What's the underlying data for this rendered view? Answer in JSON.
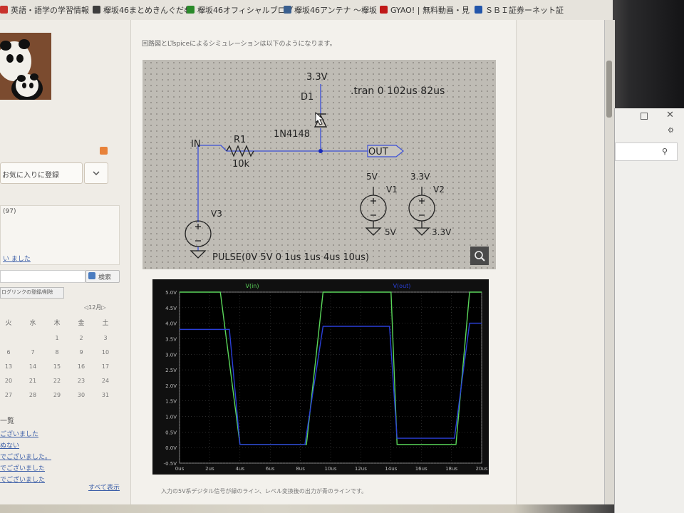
{
  "bookmarks": [
    {
      "label": "英語・語学の学習情報",
      "color": "#c8322c"
    },
    {
      "label": "欅坂46まとめきんぐだむ",
      "color": "#3d3d3d"
    },
    {
      "label": "欅坂46オフィシャルブログ",
      "color": "#2a8a2a"
    },
    {
      "label": "欅坂46アンテナ ～欅坂",
      "color": "#3a5f8f"
    },
    {
      "label": "GYAO! | 無料動画・見",
      "color": "#c01818"
    },
    {
      "label": "ＳＢＩ証券ーネット証",
      "color": "#2255aa"
    }
  ],
  "sidebar": {
    "favorite_label": "お気に入りに登録",
    "article_count": "(97)",
    "comment_link": "い ました",
    "search_label": "検索",
    "link_register": "ログリンクの登録/削除",
    "month": "12月",
    "weekdays": [
      "火",
      "水",
      "木",
      "金",
      "土"
    ],
    "calendar_rows": [
      [
        "",
        "",
        "1",
        "2",
        "3"
      ],
      [
        "6",
        "7",
        "8",
        "9",
        "10"
      ],
      [
        "13",
        "14",
        "15",
        "16",
        "17"
      ],
      [
        "20",
        "21",
        "22",
        "23",
        "24"
      ],
      [
        "27",
        "28",
        "29",
        "30",
        "31"
      ]
    ],
    "list_title": "一覧",
    "list_links": [
      "ございました",
      "ぬない",
      "でございました。",
      "でございました",
      "でございました"
    ],
    "show_all": "すべて表示"
  },
  "article": {
    "intro": "回路図とLTspiceによるシミュレーションは以下のようになります。",
    "footer": "入力の5V系デジタル信号が緑のライン、レベル変換後の出力が青のラインです。"
  },
  "schematic": {
    "vcc_label": "3.3V",
    "diode_name": "D1",
    "diode_model": "1N4148",
    "tran_cmd": ".tran 0 102us 82us",
    "in_label": "IN",
    "resistor_name": "R1",
    "resistor_value": "10k",
    "out_label": "OUT",
    "v1_top": "5V",
    "v1_name": "V1",
    "v1_gnd": "5V",
    "v2_top": "3.3V",
    "v2_name": "V2",
    "v2_gnd": "3.3V",
    "v3_name": "V3",
    "v3_params": "PULSE(0V 5V 0 1us 1us 4us 10us)"
  },
  "chart_data": {
    "type": "line",
    "title": "",
    "xlabel": "",
    "ylabel": "",
    "series": [
      {
        "name": "V(in)",
        "color": "#5ad65a",
        "x": [
          0,
          2.7,
          4.0,
          8.4,
          9.5,
          14.0,
          14.4,
          18.3,
          19.2,
          20
        ],
        "y": [
          5.0,
          5.0,
          0.1,
          0.1,
          5.0,
          5.0,
          0.1,
          0.1,
          5.0,
          5.0
        ]
      },
      {
        "name": "V(out)",
        "color": "#2a3fd8",
        "x": [
          0,
          3.3,
          4.0,
          8.3,
          9.5,
          13.9,
          14.4,
          18.2,
          19.2,
          20
        ],
        "y": [
          3.8,
          3.8,
          0.1,
          0.1,
          3.9,
          3.9,
          0.3,
          0.3,
          4.0,
          4.0
        ]
      }
    ],
    "xlim": [
      0,
      20
    ],
    "ylim": [
      -0.5,
      5.0
    ],
    "x_ticks": [
      "0us",
      "2us",
      "4us",
      "6us",
      "8us",
      "10us",
      "12us",
      "14us",
      "16us",
      "18us",
      "20us"
    ],
    "y_ticks": [
      "5.0V",
      "4.5V",
      "4.0V",
      "3.5V",
      "3.0V",
      "2.5V",
      "2.0V",
      "1.5V",
      "1.0V",
      "0.5V",
      "0.0V",
      "-0.5V"
    ],
    "grid": true,
    "legend": "top"
  }
}
